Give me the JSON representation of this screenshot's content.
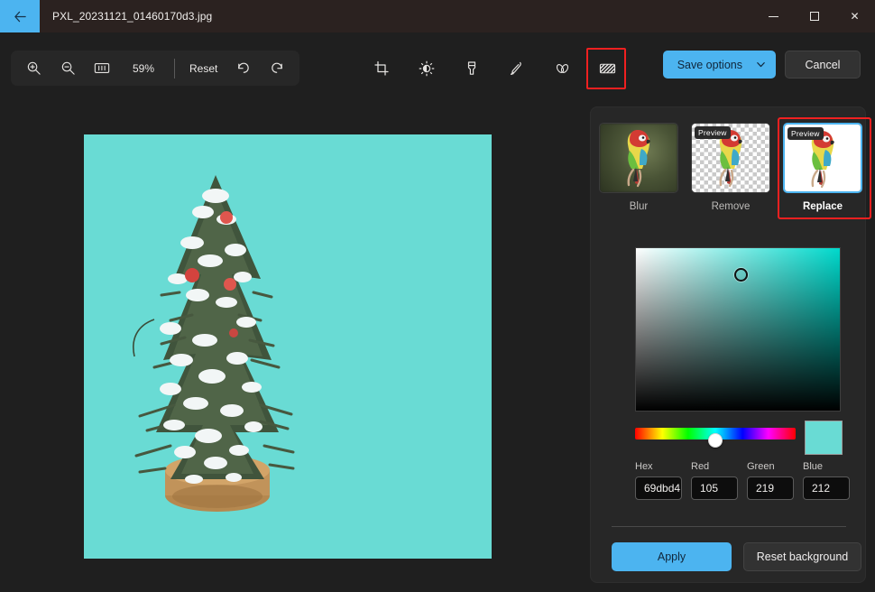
{
  "window": {
    "title": "PXL_20231121_01460170d3.jpg",
    "back_icon": "arrow-left-icon",
    "controls": {
      "minimize": "minimize-icon",
      "maximize": "maximize-icon",
      "close": "close-icon"
    }
  },
  "toolbar": {
    "zoom_in": "zoom-in-icon",
    "zoom_out": "zoom-out-icon",
    "fit_actual": "one-to-one-icon",
    "zoom_value": "59%",
    "reset_label": "Reset",
    "undo": "undo-icon",
    "redo": "redo-icon",
    "tools": [
      {
        "name": "crop-tool",
        "icon": "crop-icon"
      },
      {
        "name": "adjust-tool",
        "icon": "brightness-icon"
      },
      {
        "name": "markup-tool",
        "icon": "marker-icon"
      },
      {
        "name": "ink-tool",
        "icon": "pen-icon"
      },
      {
        "name": "erase-tool",
        "icon": "erase-objects-icon"
      },
      {
        "name": "background-tool",
        "icon": "background-icon"
      }
    ],
    "save_label": "Save options",
    "save_chevron": "chevron-down-icon",
    "cancel_label": "Cancel",
    "accent": "#4cb4f0",
    "annotation_color": "#f02020"
  },
  "canvas": {
    "image_background": "#69dbd4",
    "subject": "snow-covered-christmas-tree"
  },
  "panel": {
    "options": [
      {
        "name": "blur",
        "label": "Blur",
        "badge": "",
        "selected": false
      },
      {
        "name": "remove",
        "label": "Remove",
        "badge": "Preview",
        "selected": false
      },
      {
        "name": "replace",
        "label": "Replace",
        "badge": "Preview",
        "selected": true
      }
    ],
    "color": {
      "selected_hex": "#69dbd4",
      "hue_css": "#00d9cc",
      "fields": [
        {
          "name": "hex",
          "label": "Hex",
          "value": "69dbd4"
        },
        {
          "name": "red",
          "label": "Red",
          "value": "105"
        },
        {
          "name": "green",
          "label": "Green",
          "value": "219"
        },
        {
          "name": "blue",
          "label": "Blue",
          "value": "212"
        }
      ]
    },
    "apply_label": "Apply",
    "reset_background_label": "Reset background"
  }
}
